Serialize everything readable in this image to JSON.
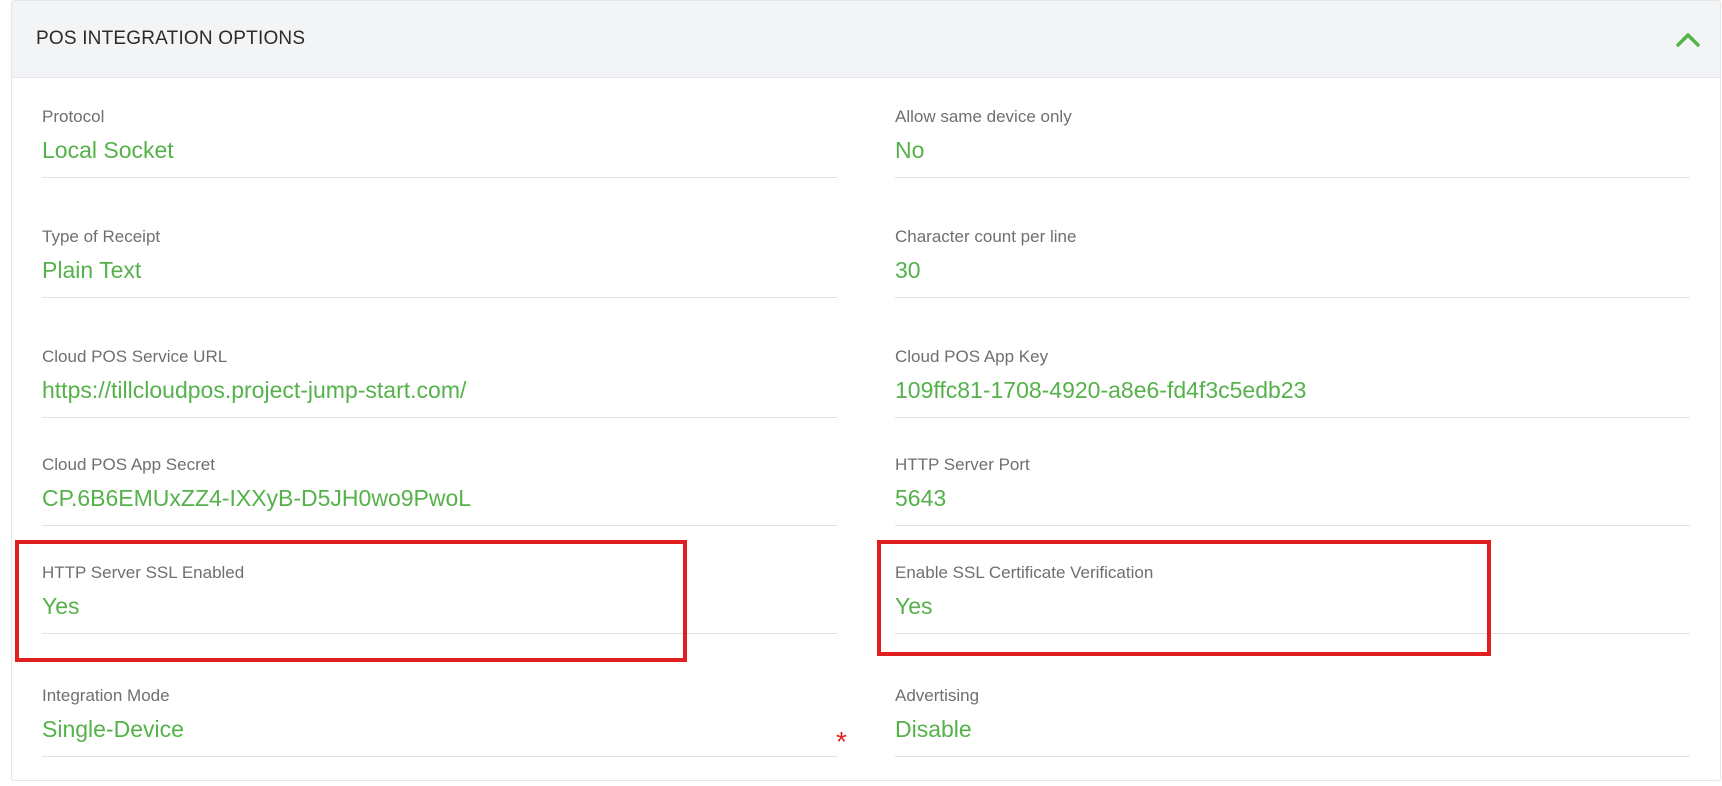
{
  "panel": {
    "title": "POS INTEGRATION OPTIONS",
    "collapse_icon": "chevron-up-icon",
    "accent_color": "#55b24a",
    "highlight_color": "#e02020"
  },
  "fields": {
    "protocol": {
      "label": "Protocol",
      "value": "Local Socket"
    },
    "allow_same_device": {
      "label": "Allow same device only",
      "value": "No"
    },
    "receipt_type": {
      "label": "Type of Receipt",
      "value": "Plain Text"
    },
    "char_count": {
      "label": "Character count per line",
      "value": "30"
    },
    "cloud_url": {
      "label": "Cloud POS Service URL",
      "value": "https://tillcloudpos.project-jump-start.com/"
    },
    "app_key": {
      "label": "Cloud POS App Key",
      "value": "109ffc81-1708-4920-a8e6-fd4f3c5edb23"
    },
    "app_secret": {
      "label": "Cloud POS App Secret",
      "value": "CP.6B6EMUxZZ4-IXXyB-D5JH0wo9PwoL"
    },
    "http_port": {
      "label": "HTTP Server Port",
      "value": "5643"
    },
    "ssl_enabled": {
      "label": "HTTP Server SSL Enabled",
      "value": "Yes"
    },
    "ssl_verify": {
      "label": "Enable SSL Certificate Verification",
      "value": "Yes"
    },
    "integration_mode": {
      "label": "Integration Mode",
      "value": "Single-Device"
    },
    "advertising": {
      "label": "Advertising",
      "value": "Disable"
    }
  },
  "required_marker": "*"
}
